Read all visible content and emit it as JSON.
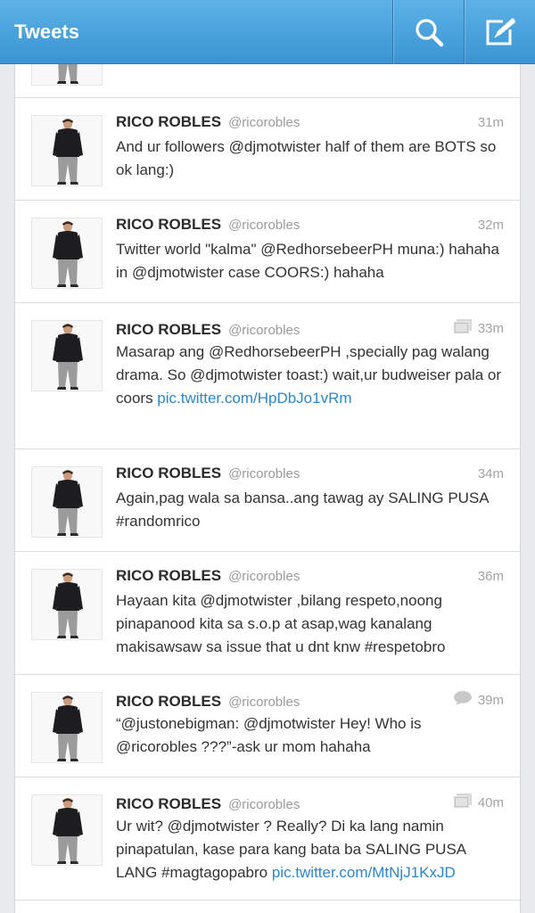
{
  "header": {
    "title": "Tweets",
    "search_icon": "search-icon",
    "compose_icon": "compose-icon"
  },
  "colors": {
    "bar": "#4aa3de",
    "link": "#2f86c6",
    "name": "#2b2b2b",
    "muted": "#9a9a9a"
  },
  "tweets": [
    {
      "name": "RICO ROBLES",
      "handle": "@ricorobles",
      "time": "31m",
      "indicator": "",
      "text": "And ur followers @djmotwister half of them are BOTS so ok lang:)",
      "link": ""
    },
    {
      "name": "RICO ROBLES",
      "handle": "@ricorobles",
      "time": "32m",
      "indicator": "",
      "text": "Twitter world \"kalma\" @RedhorsebeerPH muna:) hahaha in @djmotwister case COORS:) hahaha",
      "link": ""
    },
    {
      "name": "RICO ROBLES",
      "handle": "@ricorobles",
      "time": "33m",
      "indicator": "photo-icon",
      "text": "Masarap ang @RedhorsebeerPH ,specially pag walang drama. So @djmotwister toast:) wait,ur budweiser pala or coors ",
      "link": "pic.twitter.com/HpDbJo1vRm"
    },
    {
      "name": "RICO ROBLES",
      "handle": "@ricorobles",
      "time": "34m",
      "indicator": "",
      "text": "Again,pag wala sa bansa..ang tawag ay SALING PUSA #randomrico",
      "link": ""
    },
    {
      "name": "RICO ROBLES",
      "handle": "@ricorobles",
      "time": "36m",
      "indicator": "",
      "text": "Hayaan kita @djmotwister ,bilang respeto,noong pinapanood kita sa s.o.p at asap,wag kanalang makisawsaw sa issue that u dnt knw #respetobro",
      "link": ""
    },
    {
      "name": "RICO ROBLES",
      "handle": "@ricorobles",
      "time": "39m",
      "indicator": "conversation-icon",
      "text": "“@justonebigman: @djmotwister Hey! Who is @ricorobles ???”-ask ur mom hahaha",
      "link": ""
    },
    {
      "name": "RICO ROBLES",
      "handle": "@ricorobles",
      "time": "40m",
      "indicator": "photo-icon",
      "text": "Ur wit? @djmotwister ? Really? Di ka lang namin pinapatulan, kase para kang bata ba SALING PUSA LANG #magtagopabro ",
      "link": "pic.twitter.com/MtNjJ1KxJD"
    }
  ]
}
